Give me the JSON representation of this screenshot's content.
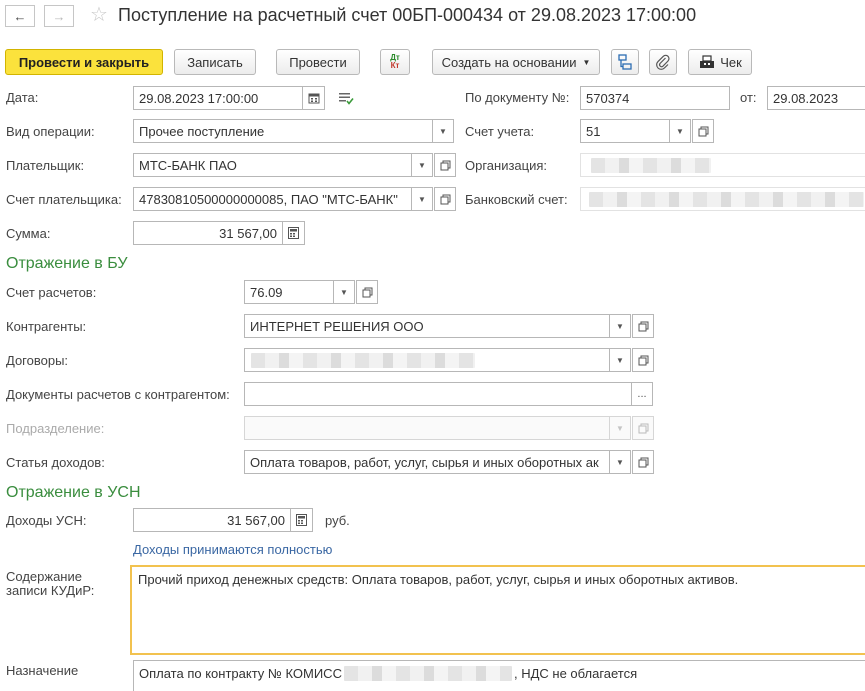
{
  "header": {
    "title": "Поступление на расчетный счет 00БП-000434 от 29.08.2023 17:00:00"
  },
  "toolbar": {
    "post_close": "Провести и закрыть",
    "save": "Записать",
    "post": "Провести",
    "dt_top": "Дт",
    "dt_bottom": "Кт",
    "create_based": "Создать на основании",
    "receipt": "Чек"
  },
  "form": {
    "date_label": "Дата:",
    "date_value": "29.08.2023 17:00:00",
    "doc_no_label": "По документу №:",
    "doc_no_value": "570374",
    "from_label": "от:",
    "from_value": "29.08.2023",
    "op_type_label": "Вид операции:",
    "op_type_value": "Прочее поступление",
    "account_label": "Счет учета:",
    "account_value": "51",
    "payer_label": "Плательщик:",
    "payer_value": "МТС-БАНК ПАО",
    "org_label": "Организация:",
    "payer_account_label": "Счет плательщика:",
    "payer_account_value": "47830810500000000085, ПАО \"МТС-БАНК\"",
    "bank_account_label": "Банковский счет:",
    "sum_label": "Сумма:",
    "sum_value": "31 567,00"
  },
  "bu": {
    "title": "Отражение в БУ",
    "settlement_label": "Счет расчетов:",
    "settlement_value": "76.09",
    "counterparty_label": "Контрагенты:",
    "counterparty_value": "ИНТЕРНЕТ РЕШЕНИЯ ООО",
    "contracts_label": "Договоры:",
    "docs_label": "Документы расчетов с контрагентом:",
    "docs_button": "...",
    "division_label": "Подразделение:",
    "income_label": "Статья доходов:",
    "income_value": "Оплата товаров, работ, услуг, сырья и иных оборотных ак"
  },
  "usn": {
    "title": "Отражение в УСН",
    "income_label": "Доходы УСН:",
    "income_value": "31 567,00",
    "currency": "руб.",
    "accepted_link": "Доходы принимаются полностью",
    "kudir_label_1": "Содержание",
    "kudir_label_2": "записи КУДиР:",
    "kudir_text": "Прочий приход денежных средств: Оплата товаров, работ, услуг, сырья и иных оборотных активов.",
    "purpose_label": "Назначение",
    "purpose_prefix": "Оплата по контракту № КОМИСС",
    "purpose_suffix": ", НДС не облагается"
  }
}
